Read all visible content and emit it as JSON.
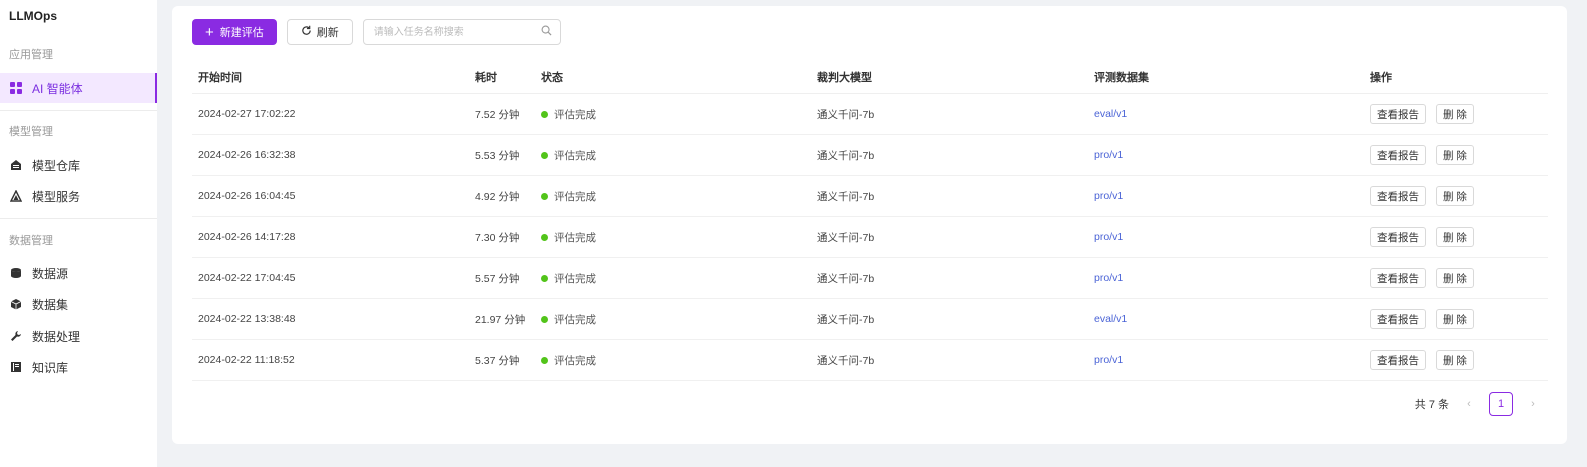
{
  "app": {
    "brand": "LLMOps"
  },
  "sidebar": {
    "groups": [
      {
        "title": "应用管理",
        "items": [
          {
            "label": "AI 智能体",
            "icon": "grid-icon",
            "active": true
          }
        ]
      },
      {
        "title": "模型管理",
        "items": [
          {
            "label": "模型仓库",
            "icon": "warehouse-icon"
          },
          {
            "label": "模型服务",
            "icon": "triangle-icon"
          }
        ]
      },
      {
        "title": "数据管理",
        "items": [
          {
            "label": "数据源",
            "icon": "database-icon"
          },
          {
            "label": "数据集",
            "icon": "box-icon"
          },
          {
            "label": "数据处理",
            "icon": "wrench-icon"
          },
          {
            "label": "知识库",
            "icon": "book-icon"
          }
        ]
      }
    ]
  },
  "toolbar": {
    "new_label": "新建评估",
    "refresh_label": "刷新",
    "search_placeholder": "请输入任务名称搜索"
  },
  "table": {
    "headers": [
      "开始时间",
      "耗时",
      "状态",
      "裁判大模型",
      "评测数据集",
      "操作"
    ],
    "rows": [
      {
        "start": "2024-02-27 17:02:22",
        "duration": "7.52 分钟",
        "status": "评估完成",
        "judge": "通义千问-7b",
        "dataset": "eval/v1"
      },
      {
        "start": "2024-02-26 16:32:38",
        "duration": "5.53 分钟",
        "status": "评估完成",
        "judge": "通义千问-7b",
        "dataset": "pro/v1"
      },
      {
        "start": "2024-02-26 16:04:45",
        "duration": "4.92 分钟",
        "status": "评估完成",
        "judge": "通义千问-7b",
        "dataset": "pro/v1"
      },
      {
        "start": "2024-02-26 14:17:28",
        "duration": "7.30 分钟",
        "status": "评估完成",
        "judge": "通义千问-7b",
        "dataset": "pro/v1"
      },
      {
        "start": "2024-02-22 17:04:45",
        "duration": "5.57 分钟",
        "status": "评估完成",
        "judge": "通义千问-7b",
        "dataset": "pro/v1"
      },
      {
        "start": "2024-02-22 13:38:48",
        "duration": "21.97 分钟",
        "status": "评估完成",
        "judge": "通义千问-7b",
        "dataset": "eval/v1"
      },
      {
        "start": "2024-02-22 11:18:52",
        "duration": "5.37 分钟",
        "status": "评估完成",
        "judge": "通义千问-7b",
        "dataset": "pro/v1"
      }
    ],
    "op_view_label": "查看报告",
    "op_delete_label": "删 除"
  },
  "pagination": {
    "total_label": "共 7 条",
    "current_page": "1",
    "prev": "‹",
    "next": "›"
  },
  "colors": {
    "accent": "#8a2be2",
    "status_done": "#52c41a",
    "link": "#4a63d6"
  }
}
